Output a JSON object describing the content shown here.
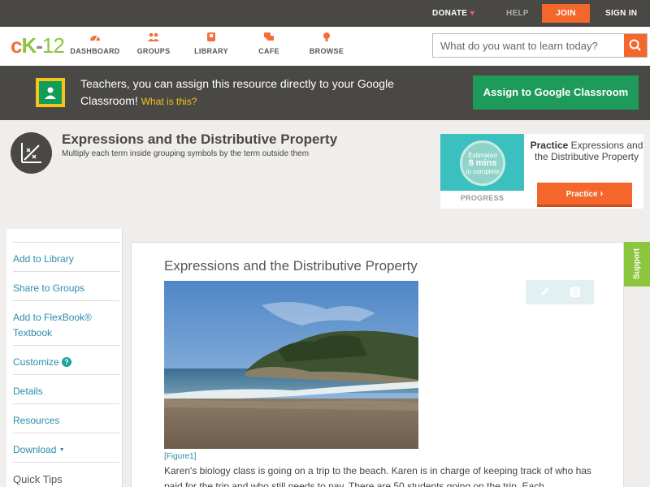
{
  "topbar": {
    "donate": "DONATE",
    "help": "HELP",
    "join": "JOIN",
    "sign_in": "SIGN IN"
  },
  "nav": {
    "logo": {
      "c": "c",
      "k": "K",
      "dash": "-",
      "num": "12"
    },
    "items": [
      {
        "label": "DASHBOARD",
        "icon": "dashboard-icon"
      },
      {
        "label": "GROUPS",
        "icon": "groups-icon"
      },
      {
        "label": "LIBRARY",
        "icon": "library-icon"
      },
      {
        "label": "CAFE",
        "icon": "cafe-icon"
      },
      {
        "label": "BROWSE",
        "icon": "browse-icon"
      }
    ],
    "search_placeholder": "What do you want to learn today?"
  },
  "band": {
    "text": "Teachers, you can assign this resource directly to your Google Classroom!",
    "what_is_this": "What is this?",
    "assign_button": "Assign to Google Classroom"
  },
  "header": {
    "title": "Expressions and the Distributive Property",
    "subtitle": "Multiply each term inside grouping symbols by the term outside them"
  },
  "practice": {
    "estimated": "Estimated",
    "mins": "8 mins",
    "to_complete": "to complete",
    "progress": "PROGRESS",
    "practice_bold": "Practice",
    "practice_rest": " Expressions and the Distributive Property",
    "button": "Practice"
  },
  "sidebar": {
    "items": [
      "Add to Library",
      "Share to Groups",
      "Add to FlexBook® Textbook",
      "Customize",
      "Details",
      "Resources",
      "Download",
      "Quick Tips"
    ],
    "help_mark": "?",
    "download_caret": "▼"
  },
  "main": {
    "title": "Expressions and the Distributive Property",
    "figure_caption": "[Figure1]",
    "body": "Karen's biology class is going on a trip to the beach. Karen is in charge of keeping track of who has paid for the trip and who still needs to pay. There are 50 students going on the trip. Each"
  },
  "support": "Support",
  "colors": {
    "accent_orange": "#f5662b",
    "dark_band": "#4a4845",
    "google_green": "#1e9b5a",
    "link_blue": "#2a8cad",
    "brand_green": "#8cc63f"
  }
}
